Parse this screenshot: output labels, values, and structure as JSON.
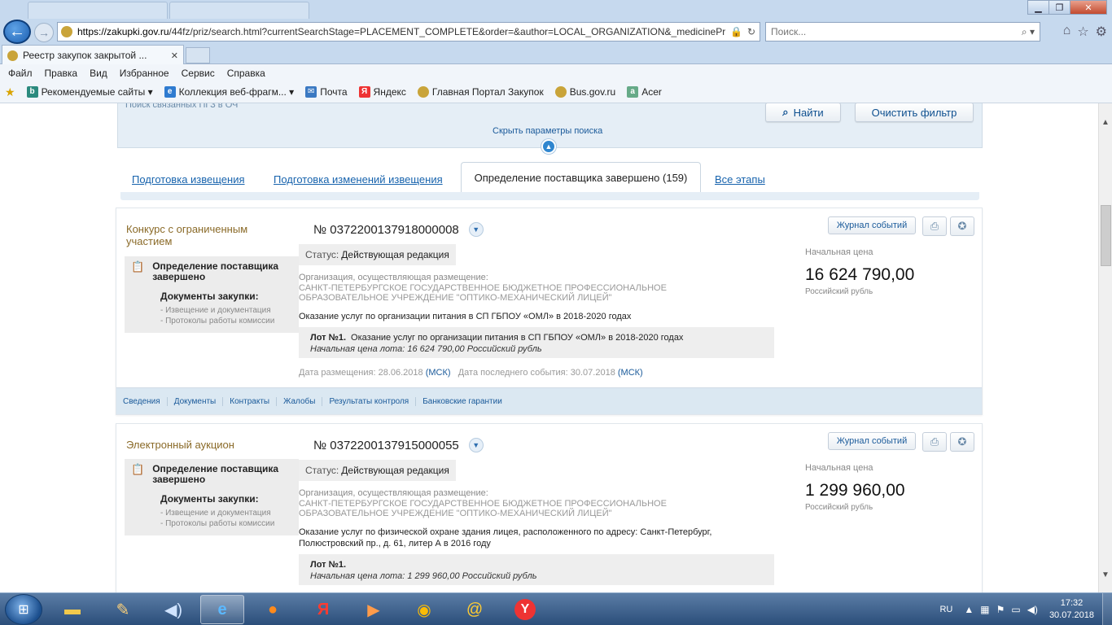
{
  "browser": {
    "url": "https://zakupki.gov.ru/44fz/priz/search.html?currentSearchStage=PLACEMENT_COMPLETE&order=&author=LOCAL_ORGANIZATION&_medicinePr",
    "url_host": "https://zakupki.gov.ru",
    "url_path": "/44fz/priz/search.html?currentSearchStage=PLACEMENT_COMPLETE&order=&author=LOCAL_ORGANIZATION&_medicinePr",
    "search_placeholder": "Поиск...",
    "active_tab_title": "Реестр закупок закрытой ...",
    "menu": [
      "Файл",
      "Правка",
      "Вид",
      "Избранное",
      "Сервис",
      "Справка"
    ],
    "favorites": [
      {
        "label": "Рекомендуемые сайты ▾",
        "icon": "bing-icon"
      },
      {
        "label": "Коллекция веб-фрагм... ▾",
        "icon": "webslice-icon"
      },
      {
        "label": "Почта",
        "icon": "mail-icon"
      },
      {
        "label": "Яндекс",
        "icon": "yandex-icon"
      },
      {
        "label": "Главная Портал Закупок",
        "icon": "emblem-icon"
      },
      {
        "label": "Bus.gov.ru",
        "icon": "emblem-icon"
      },
      {
        "label": "Acer",
        "icon": "acer-icon"
      }
    ]
  },
  "search_panel": {
    "faded_link": "Поиск связанных ПГЗ в ОЧ",
    "find_label": "Найти",
    "clear_label": "Очистить фильтр",
    "hide_params": "Скрыть параметры поиска"
  },
  "stage_tabs": {
    "prep": "Подготовка извещения",
    "prep_changes": "Подготовка изменений извещения",
    "active": "Определение поставщика завершено (159)",
    "all": "Все этапы"
  },
  "cards": [
    {
      "type": "Конкурс с ограниченным участием",
      "number": "№ 0372200137918000008",
      "journal": "Журнал событий",
      "status": "Определение поставщика завершено",
      "docs_head": "Документы закупки:",
      "docs_links": [
        "- Извещение и документация",
        "- Протоколы работы комиссии"
      ],
      "edition_label": "Статус:",
      "edition_value": "Действующая редакция",
      "org_label": "Организация, осуществляющая размещение:",
      "org_name": "САНКТ-ПЕТЕРБУРГСКОЕ ГОСУДАРСТВЕННОЕ БЮДЖЕТНОЕ ПРОФЕССИОНАЛЬНОЕ ОБРАЗОВАТЕЛЬНОЕ УЧРЕЖДЕНИЕ \"ОПТИКО-МЕХАНИЧЕСКИЙ ЛИЦЕЙ\"",
      "subject": "Оказание услуг по организации питания в СП ГБПОУ «ОМЛ» в 2018-2020 годах",
      "lot_num": "Лот №1.",
      "lot_text": "Оказание услуг по организации питания в СП ГБПОУ «ОМЛ» в 2018-2020 годах",
      "lot_price": "Начальная цена лота: 16 624 790,00 Российский рубль",
      "date_posted_label": "Дата размещения: 28.06.2018",
      "date_last_label": "Дата последнего события: 30.07.2018",
      "msk": "(МСК)",
      "price_label": "Начальная цена",
      "price": "16 624 790,00",
      "currency": "Российский рубль",
      "footer": [
        "Сведения",
        "Документы",
        "Контракты",
        "Жалобы",
        "Результаты контроля",
        "Банковские гарантии"
      ]
    },
    {
      "type": "Электронный аукцион",
      "number": "№ 0372200137915000055",
      "journal": "Журнал событий",
      "status": "Определение поставщика завершено",
      "docs_head": "Документы закупки:",
      "docs_links": [
        "- Извещение и документация",
        "- Протоколы работы комиссии"
      ],
      "edition_label": "Статус:",
      "edition_value": "Действующая редакция",
      "org_label": "Организация, осуществляющая размещение:",
      "org_name": "САНКТ-ПЕТЕРБУРГСКОЕ ГОСУДАРСТВЕННОЕ БЮДЖЕТНОЕ ПРОФЕССИОНАЛЬНОЕ ОБРАЗОВАТЕЛЬНОЕ УЧРЕЖДЕНИЕ \"ОПТИКО-МЕХАНИЧЕСКИЙ ЛИЦЕЙ\"",
      "subject": "Оказание услуг по физической охране здания лицея, расположенного по адресу: Санкт-Петербург, Полюстровский пр., д. 61, литер А в 2016 году",
      "lot_num": "Лот №1.",
      "lot_text": "",
      "lot_price": "Начальная цена лота: 1 299 960,00 Российский рубль",
      "price_label": "Начальная цена",
      "price": "1 299 960,00",
      "currency": "Российский рубль"
    }
  ],
  "taskbar": {
    "lang": "RU",
    "time": "17:32",
    "date": "30.07.2018"
  }
}
